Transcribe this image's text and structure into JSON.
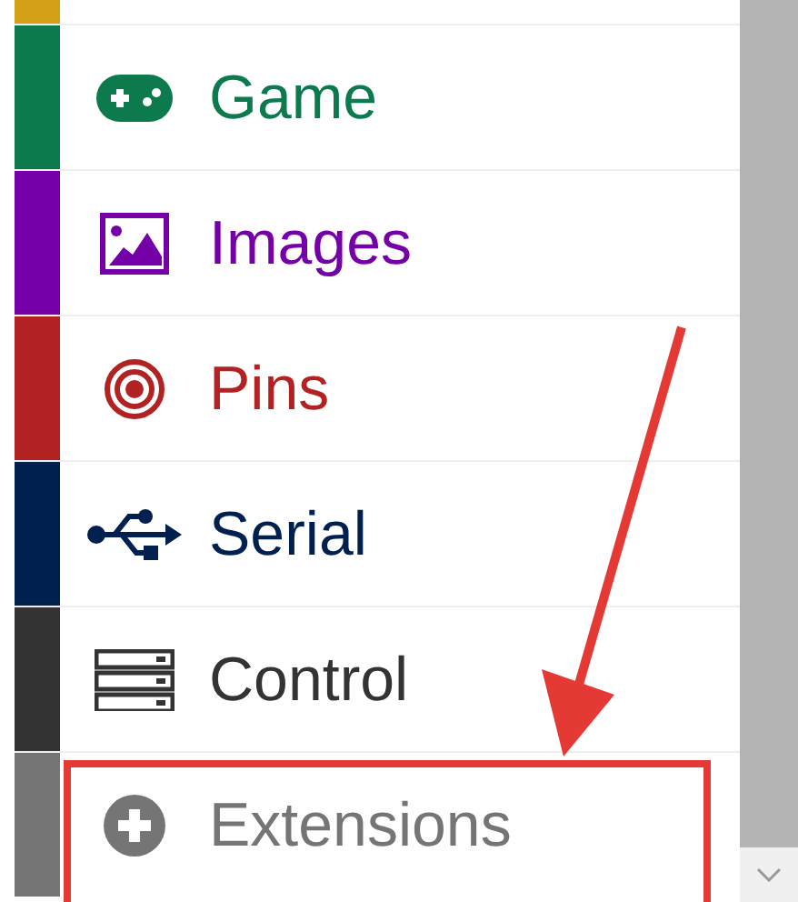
{
  "toolbox": {
    "items": [
      {
        "label": "Game",
        "kind": "game",
        "color": "#0d7a4e",
        "highlighted": false
      },
      {
        "label": "Images",
        "kind": "image",
        "color": "#7600a8",
        "highlighted": false
      },
      {
        "label": "Pins",
        "kind": "target",
        "color": "#b22222",
        "highlighted": false
      },
      {
        "label": "Serial",
        "kind": "usb",
        "color": "#002050",
        "highlighted": false
      },
      {
        "label": "Control",
        "kind": "server",
        "color": "#333333",
        "highlighted": false
      },
      {
        "label": "Extensions",
        "kind": "plus",
        "color": "#757575",
        "highlighted": true
      }
    ]
  }
}
